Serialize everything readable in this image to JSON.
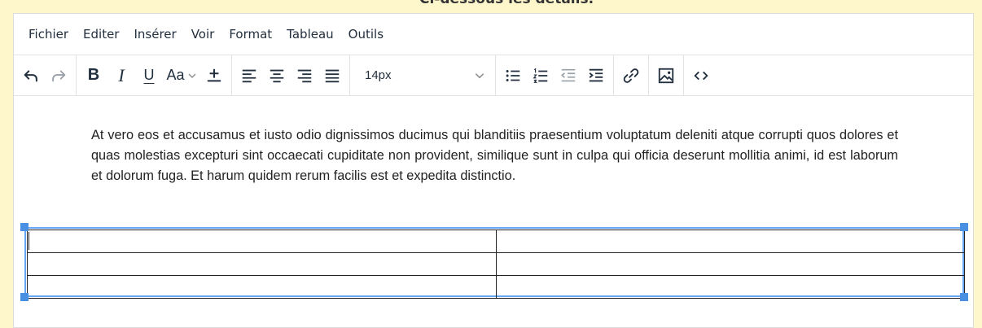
{
  "page": {
    "heading_fragment": "Ci-dessous les détails."
  },
  "menubar": {
    "items": [
      "Fichier",
      "Editer",
      "Insérer",
      "Voir",
      "Format",
      "Tableau",
      "Outils"
    ]
  },
  "toolbar": {
    "undo": "undo-icon",
    "redo": "redo-icon",
    "bold_label": "B",
    "italic_label": "I",
    "underline_label": "U",
    "font_family_label": "Aa",
    "font_size_value": "14px",
    "icons": [
      "superscript-icon",
      "align-left-icon",
      "align-center-icon",
      "align-right-icon",
      "align-justify-icon",
      "bullet-list-icon",
      "numbered-list-icon",
      "outdent-icon",
      "indent-icon",
      "link-icon",
      "image-icon",
      "code-icon"
    ]
  },
  "content": {
    "paragraph": "At vero eos et accusamus et iusto odio dignissimos ducimus qui blanditiis praesentium voluptatum deleniti atque corrupti quos dolores et quas molestias excepturi sint occaecati cupiditate non provident, similique sunt in culpa qui officia deserunt mollitia animi, id est laborum et dolorum fuga. Et harum quidem rerum facilis est et expedita distinctio.",
    "table": {
      "rows": 3,
      "cols": 2,
      "cells": [
        [
          "",
          ""
        ],
        [
          "",
          ""
        ],
        [
          "",
          ""
        ]
      ]
    }
  },
  "colors": {
    "page_background": "#fff7cc",
    "selection_accent": "#4a90e2",
    "text": "#222f3e"
  }
}
